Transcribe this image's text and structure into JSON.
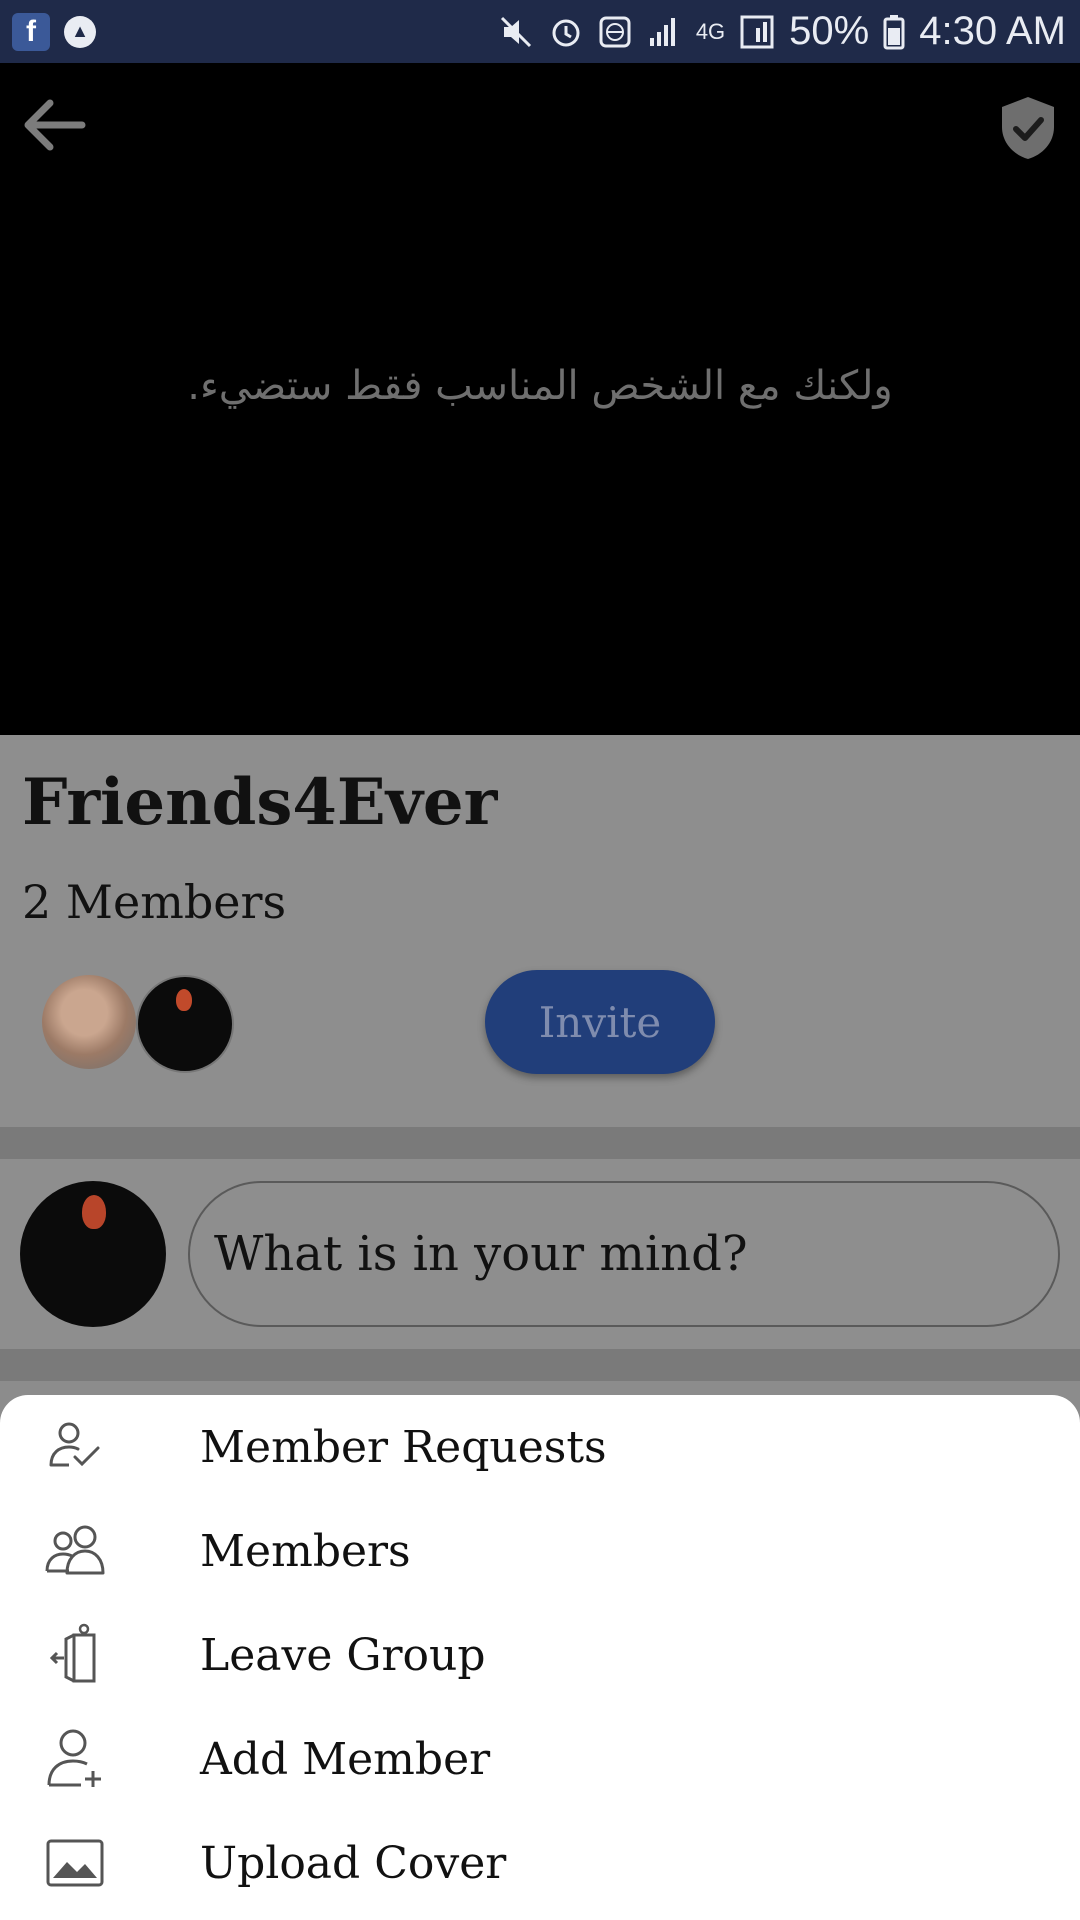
{
  "status_bar": {
    "battery_text": "50%",
    "time": "4:30 AM",
    "network_label": "4G",
    "icons": [
      "facebook-icon",
      "triangle-icon",
      "mute-icon",
      "alarm-icon",
      "globe-icon",
      "signal-icon",
      "network-icon",
      "battery-icon"
    ]
  },
  "cover": {
    "quote": "ولكنك مع الشخص المناسب فقط ستضيء."
  },
  "group": {
    "name": "Friends4Ever",
    "member_count": "2 Members",
    "invite_label": "Invite"
  },
  "composer": {
    "placeholder": "What is in your mind?"
  },
  "menu": {
    "items": [
      {
        "label": "Member Requests",
        "icon": "member-requests-icon"
      },
      {
        "label": "Members",
        "icon": "members-icon"
      },
      {
        "label": "Leave Group",
        "icon": "leave-group-icon"
      },
      {
        "label": "Add Member",
        "icon": "add-member-icon"
      },
      {
        "label": "Upload Cover",
        "icon": "upload-cover-icon"
      }
    ]
  },
  "colors": {
    "status_bar_bg": "#1f2a49",
    "invite_bg": "#213e7a",
    "overlay_bg": "#8e8e8e",
    "sheet_bg": "#ffffff"
  }
}
